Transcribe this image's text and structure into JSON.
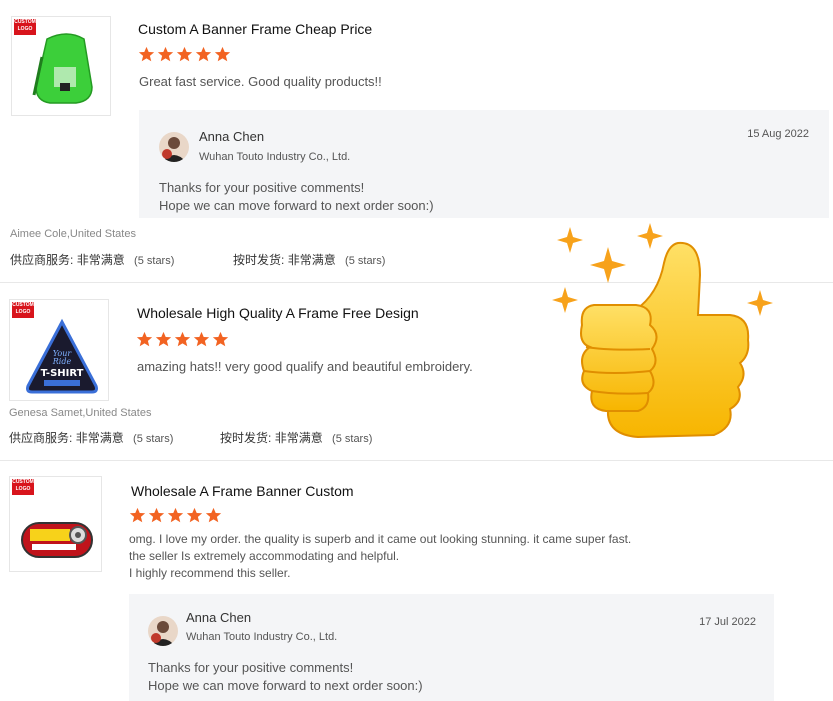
{
  "brand_logo": "CUSTOM LOGO",
  "colors": {
    "star": "#f26322",
    "reply_bg": "#f4f5f7",
    "logo_red": "#d8141c"
  },
  "reviews": [
    {
      "title": "Custom A Banner Frame Cheap Price",
      "rating": 5,
      "comment_lines": [
        "Great fast service. Good quality products!!"
      ],
      "product_icon": "green-backpack-icon",
      "reply": {
        "name": "Anna Chen",
        "company": "Wuhan Touto Industry Co., Ltd.",
        "date": "15 Aug 2022",
        "lines": [
          "Thanks for your positive comments!",
          "Hope we can move forward to next order soon:)"
        ]
      },
      "buyer": "Aimee Cole,United States",
      "supplier_service_label": "供应商服务:",
      "supplier_service_value": "非常满意",
      "supplier_service_stars": "(5 stars)",
      "ontime_label": "按时发货:",
      "ontime_value": "非常满意",
      "ontime_stars": "(5 stars)"
    },
    {
      "title": "Wholesale High Quality A Frame Free Design",
      "rating": 5,
      "comment_lines": [
        "amazing hats!! very good qualify and beautiful embroidery."
      ],
      "product_icon": "tshirt-patch-icon",
      "buyer": "Genesa Samet,United States",
      "supplier_service_label": "供应商服务:",
      "supplier_service_value": "非常满意",
      "supplier_service_stars": "(5 stars)",
      "ontime_label": "按时发货:",
      "ontime_value": "非常满意",
      "ontime_stars": "(5 stars)"
    },
    {
      "title": "Wholesale A Frame Banner Custom",
      "rating": 5,
      "comment_lines": [
        "omg. I love my order. the quality is superb and it came out looking stunning. it came super fast.",
        "the seller Is extremely accommodating and helpful.",
        "I highly recommend this seller."
      ],
      "product_icon": "tire-badge-icon",
      "reply": {
        "name": "Anna Chen",
        "company": "Wuhan Touto Industry Co., Ltd.",
        "date": "17 Jul 2022",
        "lines": [
          "Thanks for your positive comments!",
          "Hope we can move forward to next order soon:)"
        ]
      }
    }
  ]
}
